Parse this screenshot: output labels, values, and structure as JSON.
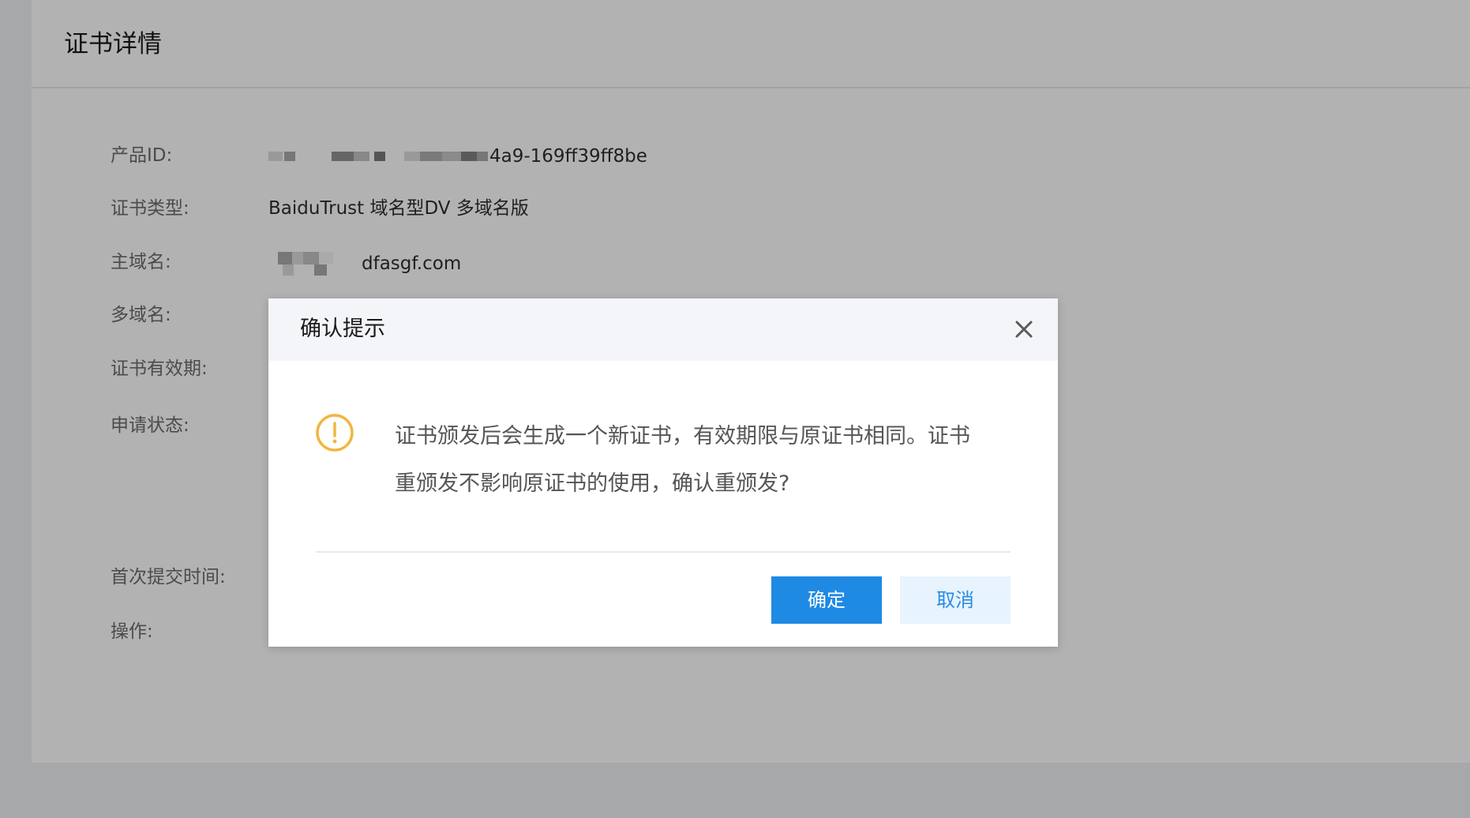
{
  "page": {
    "title": "证书详情"
  },
  "details": {
    "product_id_label": "产品ID:",
    "product_id_value": "4a9-169ff39ff8be",
    "cert_type_label": "证书类型:",
    "cert_type_value": "BaiduTrust 域名型DV 多域名版",
    "main_domain_label": "主域名:",
    "main_domain_value": "dfasgf.com",
    "multi_domain_label": "多域名:",
    "validity_label": "证书有效期:",
    "status_label": "申请状态:",
    "first_submit_label": "首次提交时间:",
    "operation_label": "操作:"
  },
  "modal": {
    "title": "确认提示",
    "message_line1": "证书颁发后会生成一个新证书，有效期限与原证书相同。证书",
    "message_line2": "重颁发不影响原证书的使用，确认重颁发?",
    "confirm_label": "确定",
    "cancel_label": "取消",
    "close_icon": "close-icon",
    "warning_icon": "warning-icon"
  },
  "colors": {
    "primary": "#1f8ae4",
    "cancel_bg": "#e7f3fd",
    "warning": "#f2b53f",
    "overlay": "#a6a8aa"
  }
}
